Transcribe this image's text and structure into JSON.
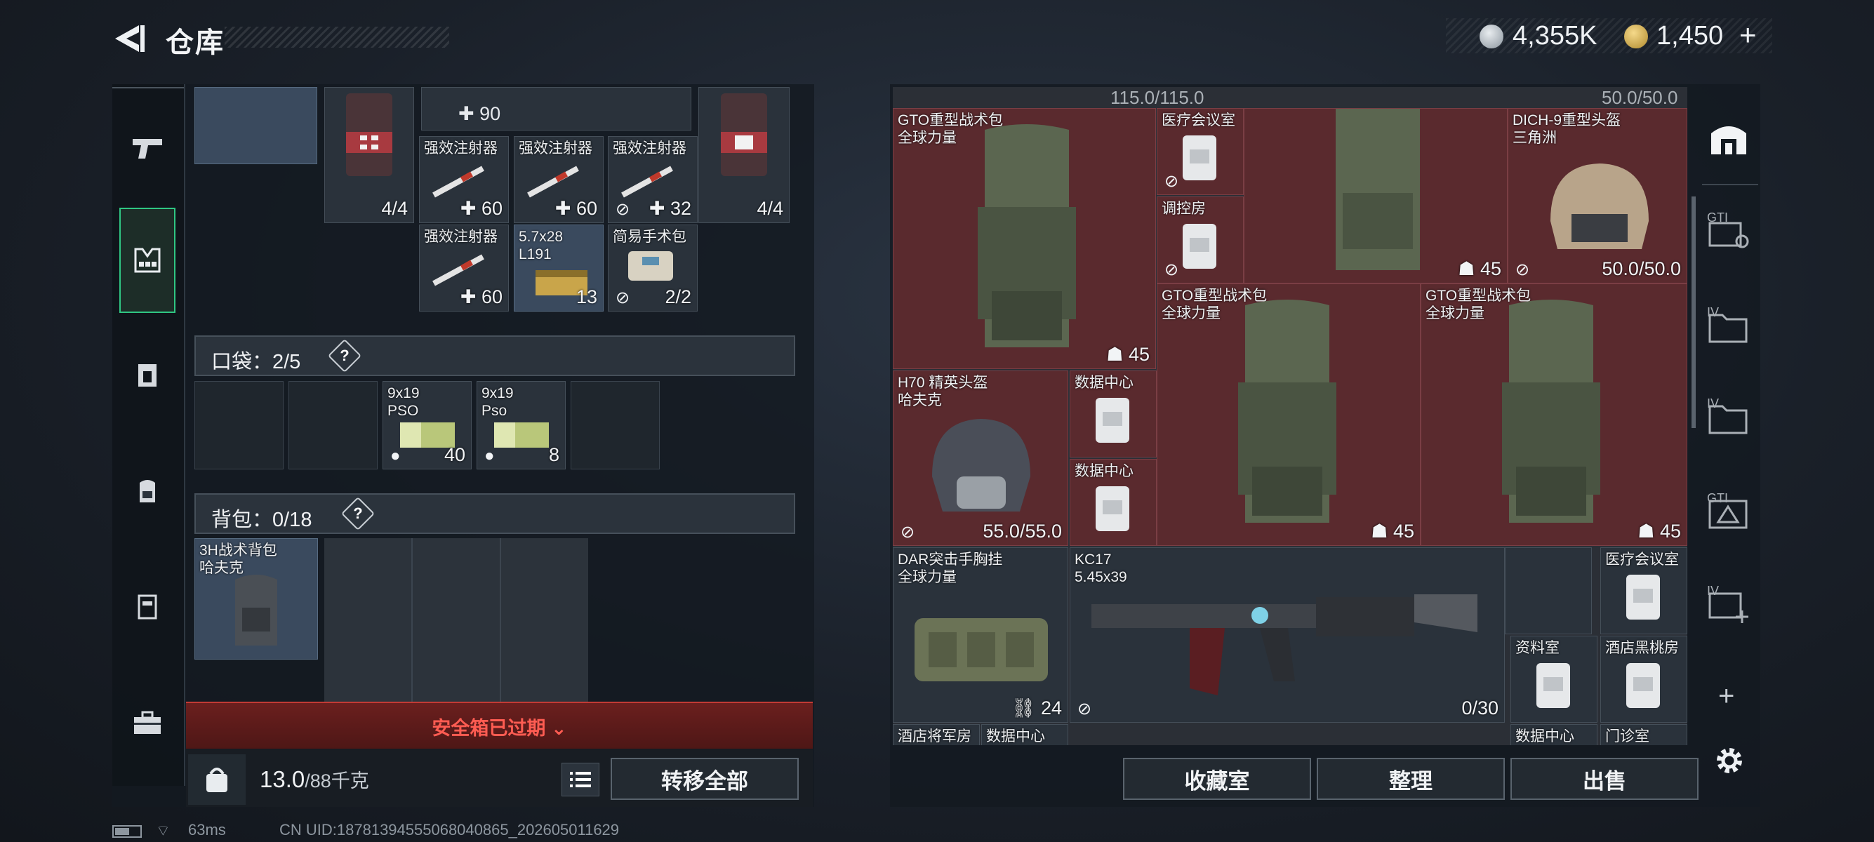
{
  "header": {
    "title": "仓库",
    "currency_1": "4,355K",
    "currency_2": "1,450",
    "add_symbol": "+"
  },
  "left_tabs": [
    {
      "icon": "pistol-icon"
    },
    {
      "icon": "chest-rig-icon",
      "active": true
    },
    {
      "icon": "armor-icon"
    },
    {
      "icon": "backpack-icon"
    },
    {
      "icon": "case-icon"
    },
    {
      "icon": "toolbox-icon"
    }
  ],
  "container_items": [
    {
      "name": "强效注射器",
      "qty": "60",
      "marker": "+"
    },
    {
      "name": "强效注射器",
      "qty": "60",
      "marker": "+"
    },
    {
      "name": "强效注射器",
      "qty": "32",
      "marker": "+"
    },
    {
      "name": "强效注射器",
      "qty": "60",
      "marker": "+"
    },
    {
      "name": "5.7x28\nL191",
      "qty": "13"
    },
    {
      "name": "简易手术包",
      "qty": "2/2"
    }
  ],
  "container_top": {
    "medkit_qty_1": "4/4",
    "medkit_qty_2": "4/4",
    "partial_qty": "90"
  },
  "pocket": {
    "label": "口袋：2/5",
    "help": "?",
    "items": [
      {
        "name": "9x19\nPSO",
        "qty": "40"
      },
      {
        "name": "9x19\nPso",
        "qty": "8"
      }
    ]
  },
  "backpack": {
    "label": "背包：0/18",
    "help": "?",
    "item_name": "3H战术背包\n哈夫克"
  },
  "safebox": {
    "expired_text": "安全箱已过期"
  },
  "weight": {
    "value": "13.0",
    "unit": "/88千克"
  },
  "buttons": {
    "transfer_all": "转移全部",
    "collection": "收藏室",
    "organize": "整理",
    "sell": "出售"
  },
  "stash": {
    "top_values": [
      "115.0/115.0",
      "50.0/50.0"
    ],
    "items": {
      "gto1": {
        "name": "GTO重型战术包\n全球力量",
        "qty": "45"
      },
      "med_room": {
        "name": "医疗会议室"
      },
      "control_room": {
        "name": "调控房"
      },
      "mid_pack_qty": "45",
      "helmet_dich": {
        "name": "DICH-9重型头盔\n三角洲",
        "qty": "50.0/50.0"
      },
      "gto2": {
        "name": "GTO重型战术包\n全球力量",
        "qty": "45"
      },
      "gto3": {
        "name": "GTO重型战术包\n全球力量",
        "qty": "45"
      },
      "helmet_h70": {
        "name": "H70 精英头盔\n哈夫克",
        "qty": "55.0/55.0"
      },
      "data1": {
        "name": "数据中心"
      },
      "data2": {
        "name": "数据中心"
      },
      "dar": {
        "name": "DAR突击手胸挂\n全球力量",
        "qty": "24"
      },
      "kc17": {
        "name": "KC17\n5.45x39",
        "qty": "0/30"
      },
      "med_room2": {
        "name": "医疗会议室"
      },
      "archive": {
        "name": "资料室"
      },
      "hotel_peach": {
        "name": "酒店黑桃房"
      },
      "hotel_general": {
        "name": "酒店将军房"
      },
      "data3": {
        "name": "数据中心"
      },
      "data4": {
        "name": "数据中心"
      },
      "clinic": {
        "name": "门诊室"
      }
    }
  },
  "right_side_icons": [
    "safe-house-icon",
    "gti-key-icon",
    "iv-folder-icon",
    "iv-folder-icon",
    "gt-triangle-icon",
    "iv-add-icon",
    "plus-icon"
  ],
  "right_side_labels": [
    "GTI",
    "IV",
    "IV",
    "GTI",
    "IV"
  ],
  "status": {
    "ping": "63ms",
    "uid": "CN UID:18781394555068040865_202605011629"
  },
  "colors": {
    "accent_green": "#2fc783",
    "expired_red": "#ff5c52",
    "slot_red": "#5a2a2e"
  }
}
